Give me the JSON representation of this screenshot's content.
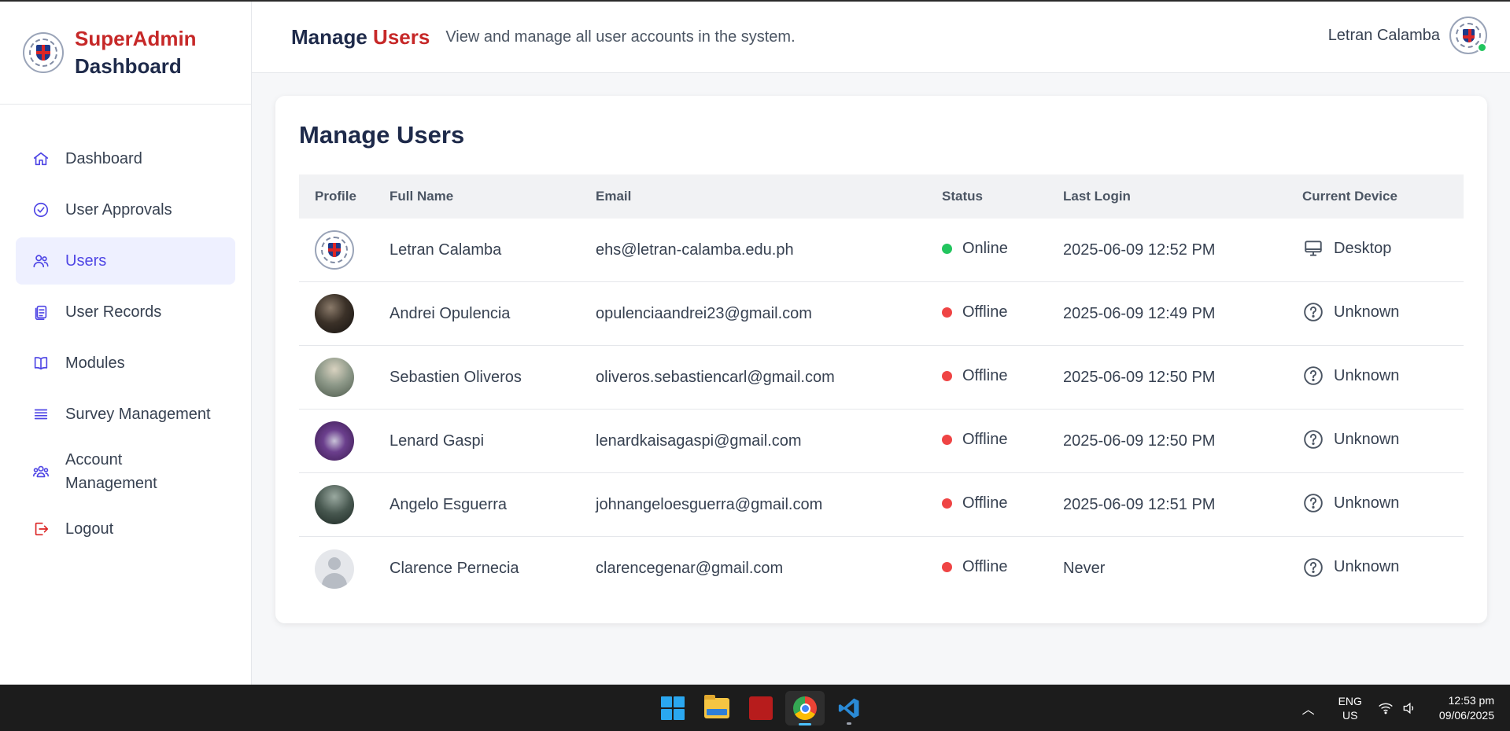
{
  "sidebar": {
    "brand": {
      "line1": "SuperAdmin",
      "line2": "Dashboard",
      "logo_icon": "school-seal-icon"
    },
    "items": [
      {
        "label": "Dashboard",
        "icon": "home-icon",
        "active": false
      },
      {
        "label": "User Approvals",
        "icon": "check-circle-icon",
        "active": false
      },
      {
        "label": "Users",
        "icon": "users-icon",
        "active": true
      },
      {
        "label": "User Records",
        "icon": "clipboard-icon",
        "active": false
      },
      {
        "label": "Modules",
        "icon": "book-icon",
        "active": false
      },
      {
        "label": "Survey Management",
        "icon": "list-icon",
        "active": false
      },
      {
        "label": "Account Management",
        "icon": "user-group-icon",
        "active": false
      },
      {
        "label": "Logout",
        "icon": "logout-icon",
        "active": false
      }
    ]
  },
  "header": {
    "title_part1": "Manage",
    "title_part2": "Users",
    "subtitle": "View and manage all user accounts in the system.",
    "user_name": "Letran Calamba",
    "user_status": "online"
  },
  "card": {
    "title": "Manage Users",
    "columns": [
      "Profile",
      "Full Name",
      "Email",
      "Status",
      "Last Login",
      "Current Device"
    ],
    "rows": [
      {
        "name": "Letran Calamba",
        "email": "ehs@letran-calamba.edu.ph",
        "status": "Online",
        "last_login": "2025-06-09 12:52 PM",
        "device": "Desktop"
      },
      {
        "name": "Andrei Opulencia",
        "email": "opulenciaandrei23@gmail.com",
        "status": "Offline",
        "last_login": "2025-06-09 12:49 PM",
        "device": "Unknown"
      },
      {
        "name": "Sebastien Oliveros",
        "email": "oliveros.sebastiencarl@gmail.com",
        "status": "Offline",
        "last_login": "2025-06-09 12:50 PM",
        "device": "Unknown"
      },
      {
        "name": "Lenard Gaspi",
        "email": "lenardkaisagaspi@gmail.com",
        "status": "Offline",
        "last_login": "2025-06-09 12:50 PM",
        "device": "Unknown"
      },
      {
        "name": "Angelo Esguerra",
        "email": "johnangeloesguerra@gmail.com",
        "status": "Offline",
        "last_login": "2025-06-09 12:51 PM",
        "device": "Unknown"
      },
      {
        "name": "Clarence Pernecia",
        "email": "clarencegenar@gmail.com",
        "status": "Offline",
        "last_login": "Never",
        "device": "Unknown"
      }
    ]
  },
  "colors": {
    "brand_red": "#c62828",
    "brand_navy": "#1e2a4a",
    "accent": "#4f46e5",
    "online": "#22c55e",
    "offline": "#ef4444"
  },
  "taskbar": {
    "apps": [
      "windows-start-icon",
      "file-explorer-icon",
      "red-app-icon",
      "chrome-icon",
      "vscode-icon"
    ],
    "lang_line1": "ENG",
    "lang_line2": "US",
    "time": "12:53 pm",
    "date": "09/06/2025"
  }
}
